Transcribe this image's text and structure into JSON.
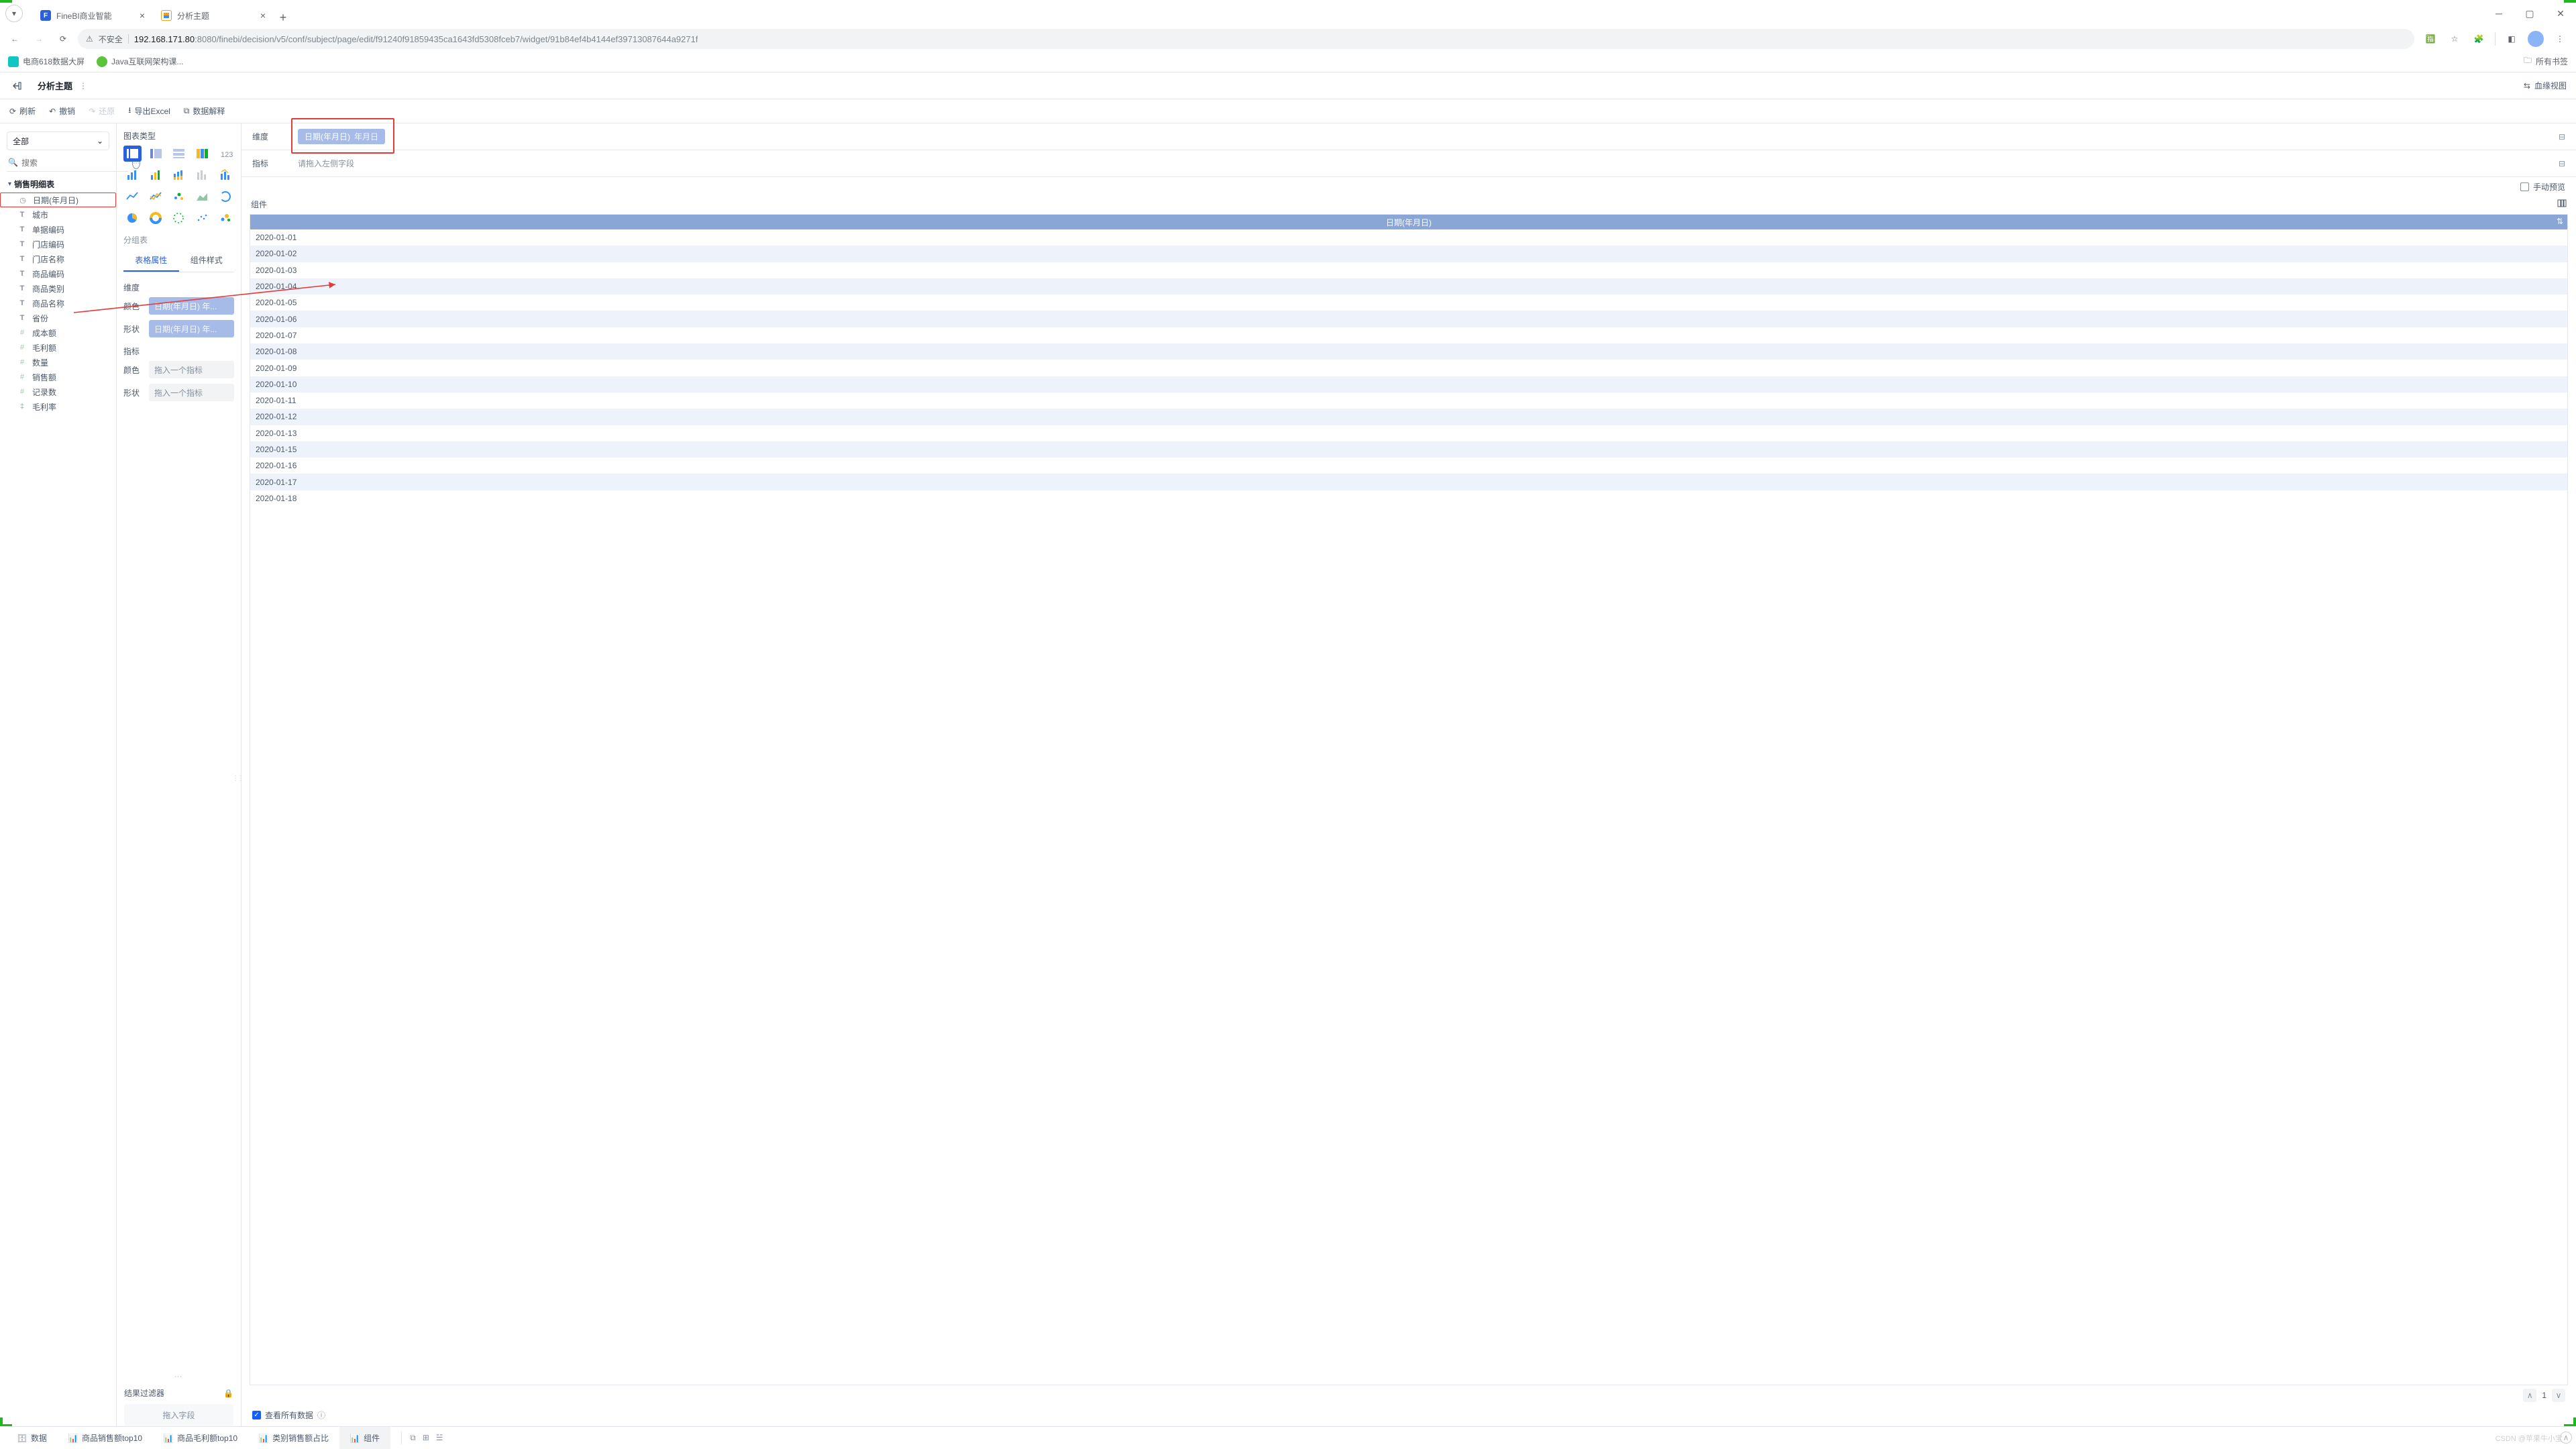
{
  "browser": {
    "tabs": [
      {
        "title": "FineBI商业智能",
        "active": false
      },
      {
        "title": "分析主题",
        "active": true
      }
    ],
    "insecure_label": "不安全",
    "url_host": "192.168.171.80",
    "url_port_path": ":8080/finebi/decision/v5/conf/subject/page/edit/f91240f91859435ca1643fd5308fceb7/widget/91b84ef4b4144ef39713087644a9271f",
    "bookmarks": [
      {
        "label": "电商618数据大屏"
      },
      {
        "label": "Java互联网架构课..."
      }
    ],
    "all_bookmarks": "所有书签"
  },
  "app": {
    "title": "分析主题",
    "lineage": "血缘视图"
  },
  "toolbar": {
    "refresh": "刷新",
    "undo": "撤销",
    "redo": "还原",
    "export": "导出Excel",
    "explain": "数据解释"
  },
  "fields_panel": {
    "all": "全部",
    "search_placeholder": "搜索",
    "table_name": "销售明细表",
    "fields": [
      {
        "type": "clock",
        "label": "日期(年月日)",
        "highlight": true
      },
      {
        "type": "t",
        "label": "城市"
      },
      {
        "type": "t",
        "label": "单据编码"
      },
      {
        "type": "t",
        "label": "门店编码"
      },
      {
        "type": "t",
        "label": "门店名称"
      },
      {
        "type": "t",
        "label": "商品编码"
      },
      {
        "type": "t",
        "label": "商品类别"
      },
      {
        "type": "t",
        "label": "商品名称"
      },
      {
        "type": "t",
        "label": "省份"
      },
      {
        "type": "hash",
        "label": "成本额"
      },
      {
        "type": "hash",
        "label": "毛利额"
      },
      {
        "type": "hash",
        "label": "数量"
      },
      {
        "type": "hash",
        "label": "销售额"
      },
      {
        "type": "hash",
        "label": "记录数"
      },
      {
        "type": "calc",
        "label": "毛利率"
      }
    ]
  },
  "chart_panel": {
    "chart_type_label": "图表类型",
    "group_label": "分组表",
    "tab_attrs": "表格属性",
    "tab_style": "组件样式",
    "section_dim": "维度",
    "attr_color": "颜色",
    "attr_shape": "形状",
    "pill_date": "日期(年月日)",
    "pill_suffix": "年...",
    "section_meas": "指标",
    "drop_metric_placeholder": "拖入一个指标",
    "filter_label": "结果过滤器",
    "filter_placeholder": "拖入字段"
  },
  "main": {
    "dim_label": "维度",
    "dim_pill": "日期(年月日)",
    "dim_pill_suffix": "年月日",
    "meas_label": "指标",
    "meas_placeholder": "请拖入左侧字段",
    "manual_preview": "手动预览",
    "component_label": "组件",
    "table_header": "日期(年月日)",
    "rows": [
      "2020-01-01",
      "2020-01-02",
      "2020-01-03",
      "2020-01-04",
      "2020-01-05",
      "2020-01-06",
      "2020-01-07",
      "2020-01-08",
      "2020-01-09",
      "2020-01-10",
      "2020-01-11",
      "2020-01-12",
      "2020-01-13",
      "2020-01-15",
      "2020-01-16",
      "2020-01-17",
      "2020-01-18"
    ],
    "page": "1",
    "view_all": "查看所有数据"
  },
  "bottom": {
    "tabs": [
      {
        "icon": "db",
        "label": "数据"
      },
      {
        "icon": "chart",
        "label": "商品销售额top10"
      },
      {
        "icon": "chart",
        "label": "商品毛利额top10"
      },
      {
        "icon": "chart",
        "label": "类别销售额占比"
      },
      {
        "icon": "chart",
        "label": "组件",
        "active": true
      }
    ],
    "watermark": "CSDN @苹果牛小宝"
  }
}
